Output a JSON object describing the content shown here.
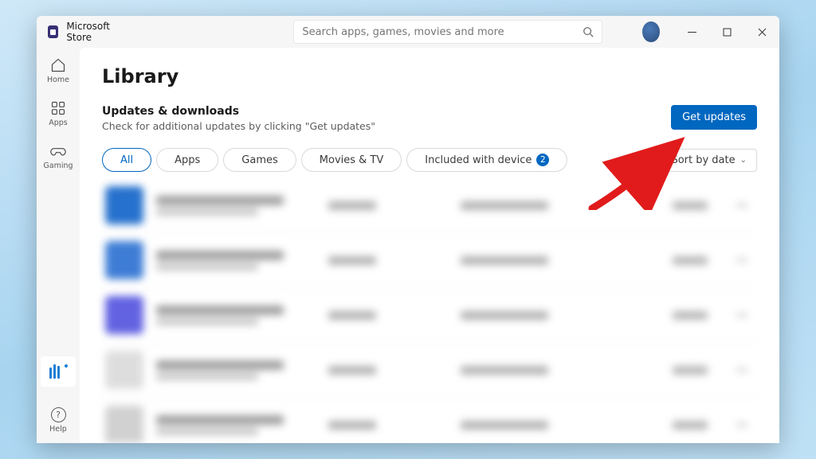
{
  "app": {
    "title": "Microsoft Store"
  },
  "search": {
    "placeholder": "Search apps, games, movies and more"
  },
  "nav": {
    "home": {
      "label": "Home"
    },
    "apps": {
      "label": "Apps"
    },
    "gaming": {
      "label": "Gaming"
    },
    "help": {
      "label": "Help"
    }
  },
  "page": {
    "title": "Library"
  },
  "section": {
    "title": "Updates & downloads",
    "subtitle": "Check for additional updates by clicking \"Get updates\"",
    "button": "Get updates"
  },
  "filters": {
    "all": "All",
    "apps": "Apps",
    "games": "Games",
    "movies": "Movies & TV",
    "included": "Included with device",
    "included_badge": "2"
  },
  "sort": {
    "label": "Sort by date"
  }
}
